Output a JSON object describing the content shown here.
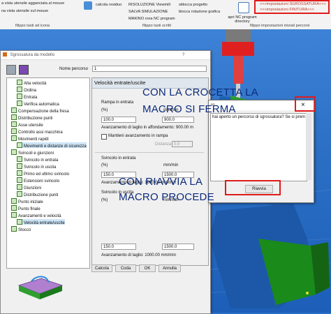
{
  "ribbon": {
    "row1_left": "a vista utensile agganciata al mouse",
    "row2_left": "na vista utensile sul mouse",
    "calc": "calcola residuo",
    "viewmill": "RISOLUZIONE Viewmill",
    "sim": "SALVA SIMULAZIONE",
    "makino": "MAKINO crea NC program",
    "sblocca_prog": "sblocca progetto",
    "sblocca_rot": "blocca rotazione grafica",
    "apri_nc": "apri NC program directory",
    "imp_sgross": ">>>impostazioni SGROSSATURA<<<",
    "imp_finit": ">>>impostazioni FINITURA<<<",
    "grp1": "filippo tasti ad icona",
    "grp2": "filippo tasti scritti",
    "grp3": "filippo impostazioni iniziali percorsi"
  },
  "dialog": {
    "title": "Sgrossatura da modello",
    "help": "?",
    "nome_label": "Nome percorso",
    "nome_value": "1",
    "section": "Velocità entrate/uscite",
    "tree": [
      {
        "label": "Alta velocità",
        "indent": 1
      },
      {
        "label": "Ordina",
        "indent": 1
      },
      {
        "label": "Entrata",
        "indent": 1
      },
      {
        "label": "Verifica automatica",
        "indent": 1
      },
      {
        "label": "Compensazione della fresa",
        "indent": 0
      },
      {
        "label": "Distribuzione punti",
        "indent": 0
      },
      {
        "label": "Asse utensile",
        "indent": 0
      },
      {
        "label": "Controllo assi macchina",
        "indent": 0
      },
      {
        "label": "Movimenti rapidi",
        "indent": 0
      },
      {
        "label": "Movimenti e distanze di sicurezza",
        "indent": 1
      },
      {
        "label": "Svincoli e giunzioni",
        "indent": 0
      },
      {
        "label": "Svincolo in entrata",
        "indent": 1
      },
      {
        "label": "Svincolo in uscita",
        "indent": 1
      },
      {
        "label": "Primo ed ultimo svincolo",
        "indent": 1
      },
      {
        "label": "Estensioni svincolo",
        "indent": 1
      },
      {
        "label": "Giunzioni",
        "indent": 1
      },
      {
        "label": "Distribuzione punti",
        "indent": 1
      },
      {
        "label": "Punto iniziale",
        "indent": 0
      },
      {
        "label": "Punto finale",
        "indent": 0
      },
      {
        "label": "Avanzamenti e velocità",
        "indent": 0
      },
      {
        "label": "Velocità entrate/uscite",
        "indent": 1
      },
      {
        "label": "Stocco",
        "indent": 0
      }
    ],
    "rampa_label": "Rampa in entrata",
    "pct": "(%)",
    "mmmin": "mm/min",
    "rampa_pct": "100.0",
    "rampa_mm": "900.0",
    "avanz_taglio_aff": "Avanzamento di taglio in affondamento: 900.00 m",
    "mantieni": "Mantieni avanzamento in rampa",
    "distanza_label": "Distanza",
    "distanza_value": "0.0",
    "svincolo_entrata": "Svincolo in entrata",
    "sv_ent_pct": "150.0",
    "sv_ent_mm": "1500.0",
    "avanz_taglio1": "Avanzamento di taglio: 1000.00 mm/min",
    "svincolo_uscita": "Svincolo in uscita",
    "sv_usc_pct": "150.0",
    "sv_usc_mm": "1500.0",
    "avanz_taglio2": "Avanzamento di taglio: 1000.00 mm/min",
    "btn_calcola": "Calcola",
    "btn_coda": "Coda",
    "btn_ok": "OK",
    "btn_annulla": "Annulla"
  },
  "popup": {
    "title": "ro",
    "close": "×",
    "message": "hai aperto un percorso di sgrossatura? Se si prem",
    "riavvia": "Riavvia"
  },
  "annotations": {
    "line1": "CON LA CROCETTA LA",
    "line2": "MACRO SI FERMA",
    "line3": "CON RIAVVIA LA",
    "line4": "MACRO PROCEDE"
  }
}
